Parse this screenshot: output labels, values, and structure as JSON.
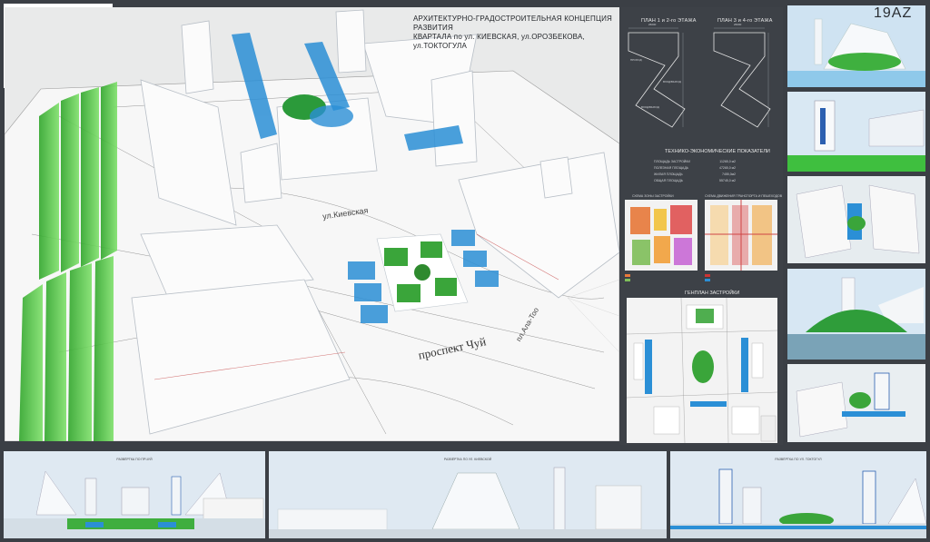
{
  "main": {
    "title_line1": "АРХИТЕКТУРНО-ГРАДОСТРОИТЕЛЬНАЯ КОНЦЕПЦИЯ РАЗВИТИЯ",
    "title_line2": "КВАРТАЛА по ул. КИЕВСКАЯ, ул.ОРОЗБЕКОВА, ул.ТОКТОГУЛА",
    "street_label_1": "ул.Киевская",
    "street_label_2": "проспект Чуй",
    "street_label_3": "пл.Ала-Тоо"
  },
  "badge": "19AZ",
  "info": {
    "plan1_title": "ПЛАН 1 и 2-го ЭТАЖА",
    "plan2_title": "ПЛАН 3 и 4-го ЭТАЖА",
    "plan_dim": "26000",
    "plan_labels": [
      "ПРОХОД",
      "ВХОД/ВЫХОД",
      "ВХОД/ВЫХОД"
    ],
    "tep_title": "ТЕХНИКО-ЭКОНОМИЧЕСКИЕ ПОКАЗАТЕЛИ",
    "tep_rows": [
      {
        "label": "ПЛОЩАДЬ ЗАСТРОЙКИ",
        "value": "11265,0 м2"
      },
      {
        "label": "ПОЛЕЗНАЯ ПЛОЩАДЬ",
        "value": "47265,0 м2"
      },
      {
        "label": "ЖИЛАЯ ПЛОЩАДЬ",
        "value": "7455,0м2"
      },
      {
        "label": "ОБЩАЯ ПЛОЩАДЬ",
        "value": "55745,0 м2"
      }
    ],
    "scheme1_title": "СХЕМА  ЗОНЫ  ЗАСТРОЙКИ",
    "scheme2_title": "СХЕМА  ДВИЖЕНИЯ ТРАНСПОРТА И ПЕШЕХОДОВ",
    "genplan_title": "ГЕНПЛАН ЗАСТРОЙКИ"
  },
  "bottom": {
    "cap1": "РАЗВЁРТКА ПО ПР.ЧУЙ",
    "cap2": "РАЗВЁРТКА ПО УЛ. КИЕВСКОЙ",
    "cap3": "РАЗВЁРТКА ПО УЛ. ТОКТОГУЛ"
  },
  "colors": {
    "background": "#3b3f45",
    "green_accent": "#4fc83c",
    "blue_accent": "#2b8fd6"
  }
}
